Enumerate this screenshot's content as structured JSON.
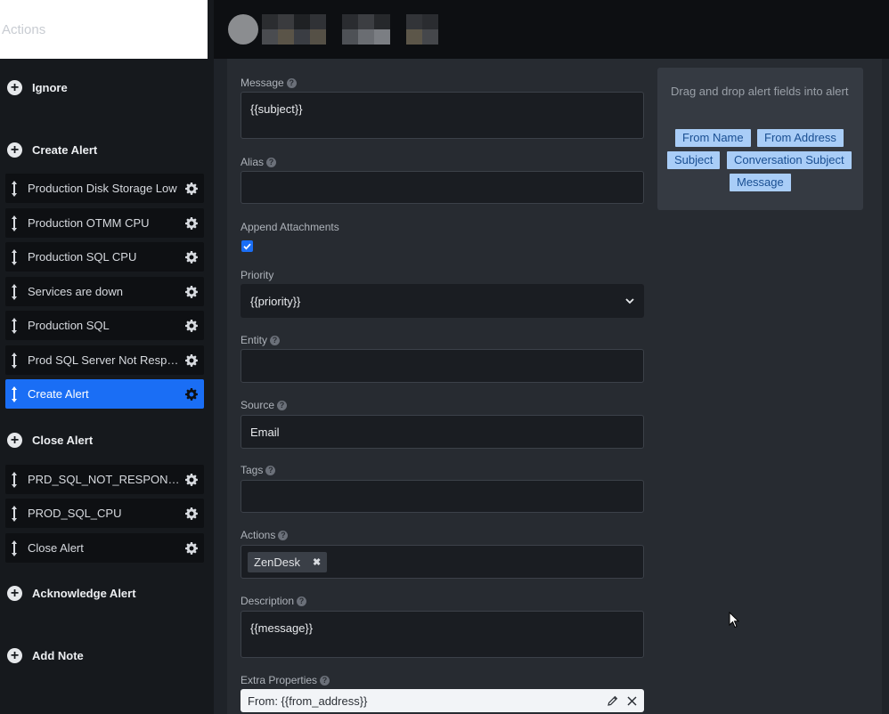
{
  "sidebar": {
    "header": "Actions",
    "groups": [
      {
        "label": "Ignore"
      },
      {
        "label": "Create Alert"
      },
      {
        "label": "Close Alert"
      },
      {
        "label": "Acknowledge Alert"
      },
      {
        "label": "Add Note"
      }
    ],
    "create_items": [
      {
        "label": "Production Disk Storage Low"
      },
      {
        "label": "Production OTMM CPU"
      },
      {
        "label": "Production SQL CPU"
      },
      {
        "label": "Services are down"
      },
      {
        "label": "Production SQL"
      },
      {
        "label": "Prod SQL Server Not Respo..."
      },
      {
        "label": "Create Alert",
        "active": true
      }
    ],
    "close_items": [
      {
        "label": "PRD_SQL_NOT_RESPONDING"
      },
      {
        "label": "PROD_SQL_CPU"
      },
      {
        "label": "Close Alert"
      }
    ]
  },
  "form": {
    "message": {
      "label": "Message",
      "value": "{{subject}}"
    },
    "alias": {
      "label": "Alias",
      "value": ""
    },
    "append_attachments": {
      "label": "Append Attachments",
      "checked": true
    },
    "priority": {
      "label": "Priority",
      "value": "{{priority}}"
    },
    "entity": {
      "label": "Entity",
      "value": ""
    },
    "source": {
      "label": "Source",
      "value": "Email"
    },
    "tags": {
      "label": "Tags",
      "value": ""
    },
    "actions": {
      "label": "Actions",
      "chips": [
        "ZenDesk"
      ]
    },
    "description": {
      "label": "Description",
      "value": "{{message}}"
    },
    "extra_properties": {
      "label": "Extra Properties",
      "value": "From: {{from_address}}"
    }
  },
  "drag_panel": {
    "hint": "Drag and drop alert fields into alert",
    "fields": [
      "From Name",
      "From Address",
      "Subject",
      "Conversation Subject",
      "Message"
    ]
  },
  "colors": {
    "accent": "#1a6ef5",
    "tag_bg": "#a9cdf7",
    "tag_text": "#1a4f92"
  }
}
